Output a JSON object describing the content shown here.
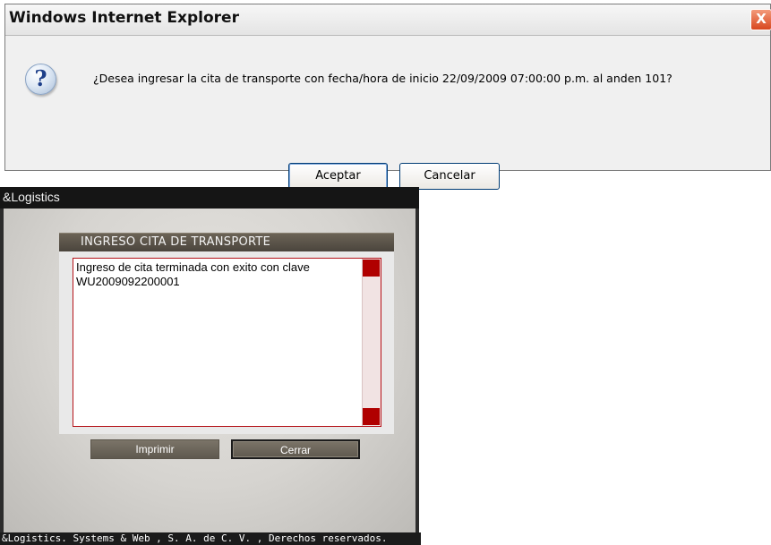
{
  "ie_dialog": {
    "title": "Windows Internet Explorer",
    "close_glyph": "X",
    "icon": "question-icon",
    "icon_glyph": "?",
    "message": "¿Desea ingresar la cita de transporte con fecha/hora de inicio 22/09/2009 07:00:00 p.m. al anden 101?",
    "buttons": {
      "accept": "Aceptar",
      "cancel": "Cancelar"
    }
  },
  "app": {
    "header_title": "&Logistics",
    "panel_title": "INGRESO CITA DE TRANSPORTE",
    "message_lines": [
      "Ingreso de cita terminada con exito con clave",
      "WU2009092200001"
    ],
    "buttons": {
      "print": "Imprimir",
      "close": "Cerrar"
    },
    "footer": "&Logistics. Systems & Web , S. A. de C. V. , Derechos reservados."
  },
  "colors": {
    "accent_red": "#b00000",
    "panel_header": "#5a5449",
    "dark_bar": "#151515"
  }
}
